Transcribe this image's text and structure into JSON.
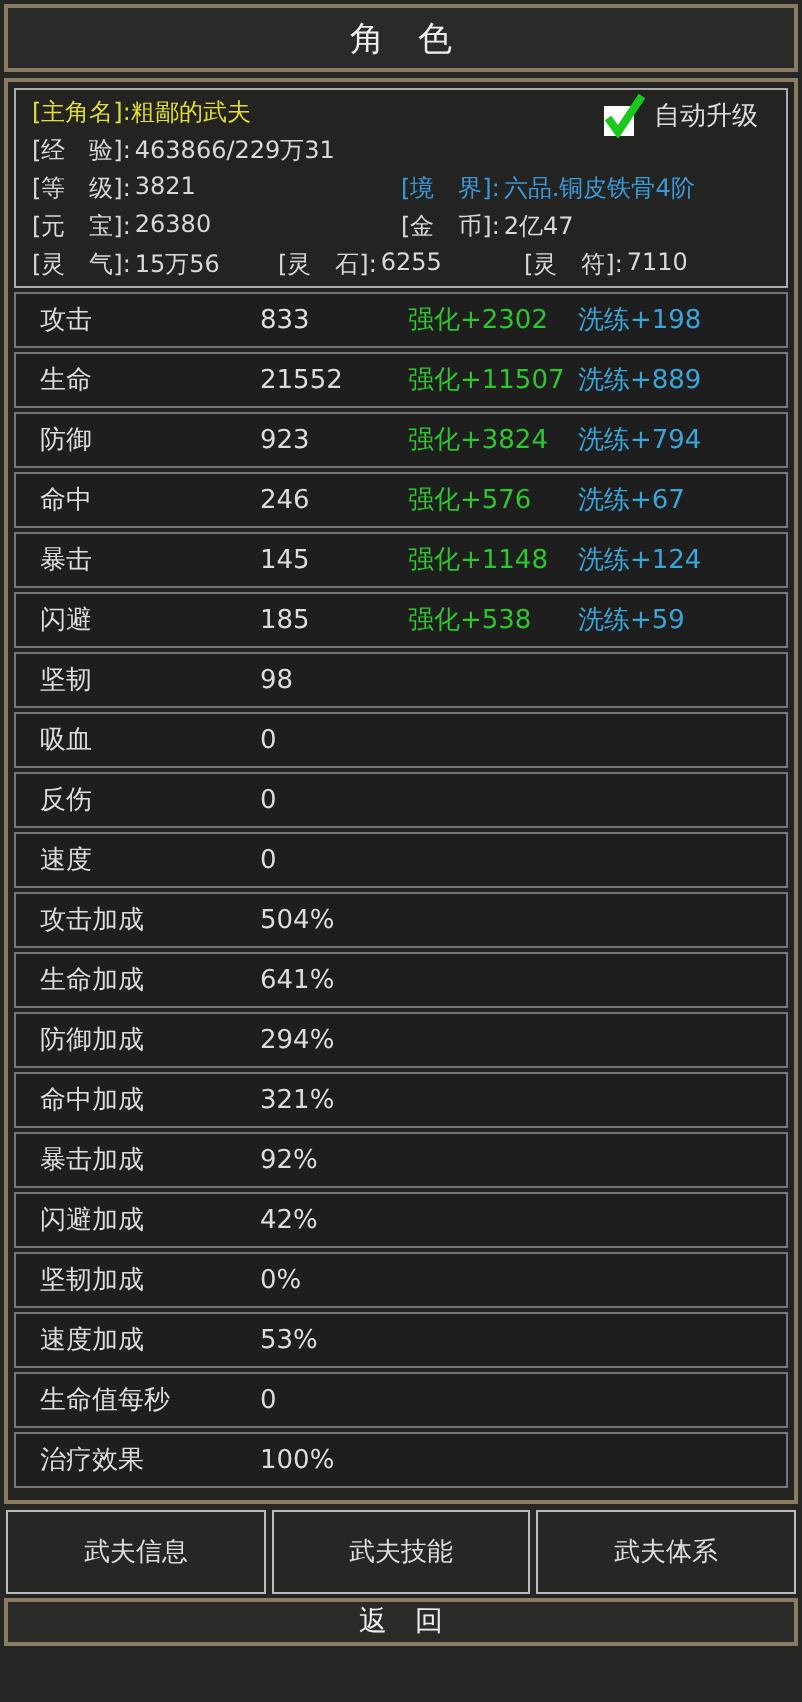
{
  "title": "角　色",
  "profile": {
    "name_label": "[主角名]:",
    "name": "粗鄙的武夫",
    "auto_upgrade": {
      "label": "自动升级",
      "checked": true
    },
    "lines": [
      [
        {
          "label": "[经　验]:",
          "value": "463866/229万31",
          "kind": "plain"
        }
      ],
      [
        {
          "label": "[等　级]:",
          "value": "3821",
          "kind": "plain"
        },
        {
          "label": "[境　界]:",
          "value": "六品.铜皮铁骨4阶",
          "kind": "realm"
        }
      ],
      [
        {
          "label": "[元　宝]:",
          "value": "26380",
          "kind": "plain"
        },
        {
          "label": "[金　币]:",
          "value": "2亿47",
          "kind": "plain"
        }
      ],
      [
        {
          "label": "[灵　气]:",
          "value": "15万56",
          "kind": "plain"
        },
        {
          "label": "[灵　石]:",
          "value": "6255",
          "kind": "plain"
        },
        {
          "label": "[灵　符]:",
          "value": "7110",
          "kind": "plain"
        }
      ]
    ]
  },
  "stats": [
    {
      "name": "攻击",
      "value": "833",
      "enhance": "强化+2302",
      "refine": "洗练+198"
    },
    {
      "name": "生命",
      "value": "21552",
      "enhance": "强化+11507",
      "refine": "洗练+889"
    },
    {
      "name": "防御",
      "value": "923",
      "enhance": "强化+3824",
      "refine": "洗练+794"
    },
    {
      "name": "命中",
      "value": "246",
      "enhance": "强化+576",
      "refine": "洗练+67"
    },
    {
      "name": "暴击",
      "value": "145",
      "enhance": "强化+1148",
      "refine": "洗练+124"
    },
    {
      "name": "闪避",
      "value": "185",
      "enhance": "强化+538",
      "refine": "洗练+59"
    },
    {
      "name": "坚韧",
      "value": "98"
    },
    {
      "name": "吸血",
      "value": "0"
    },
    {
      "name": "反伤",
      "value": "0"
    },
    {
      "name": "速度",
      "value": "0"
    },
    {
      "name": "攻击加成",
      "value": "504%"
    },
    {
      "name": "生命加成",
      "value": "641%"
    },
    {
      "name": "防御加成",
      "value": "294%"
    },
    {
      "name": "命中加成",
      "value": "321%"
    },
    {
      "name": "暴击加成",
      "value": "92%"
    },
    {
      "name": "闪避加成",
      "value": "42%"
    },
    {
      "name": "坚韧加成",
      "value": "0%"
    },
    {
      "name": "速度加成",
      "value": "53%"
    },
    {
      "name": "生命值每秒",
      "value": "0"
    },
    {
      "name": "治疗效果",
      "value": "100%"
    }
  ],
  "tabs": [
    "武夫信息",
    "武夫技能",
    "武夫体系"
  ],
  "back_button": "返　回"
}
